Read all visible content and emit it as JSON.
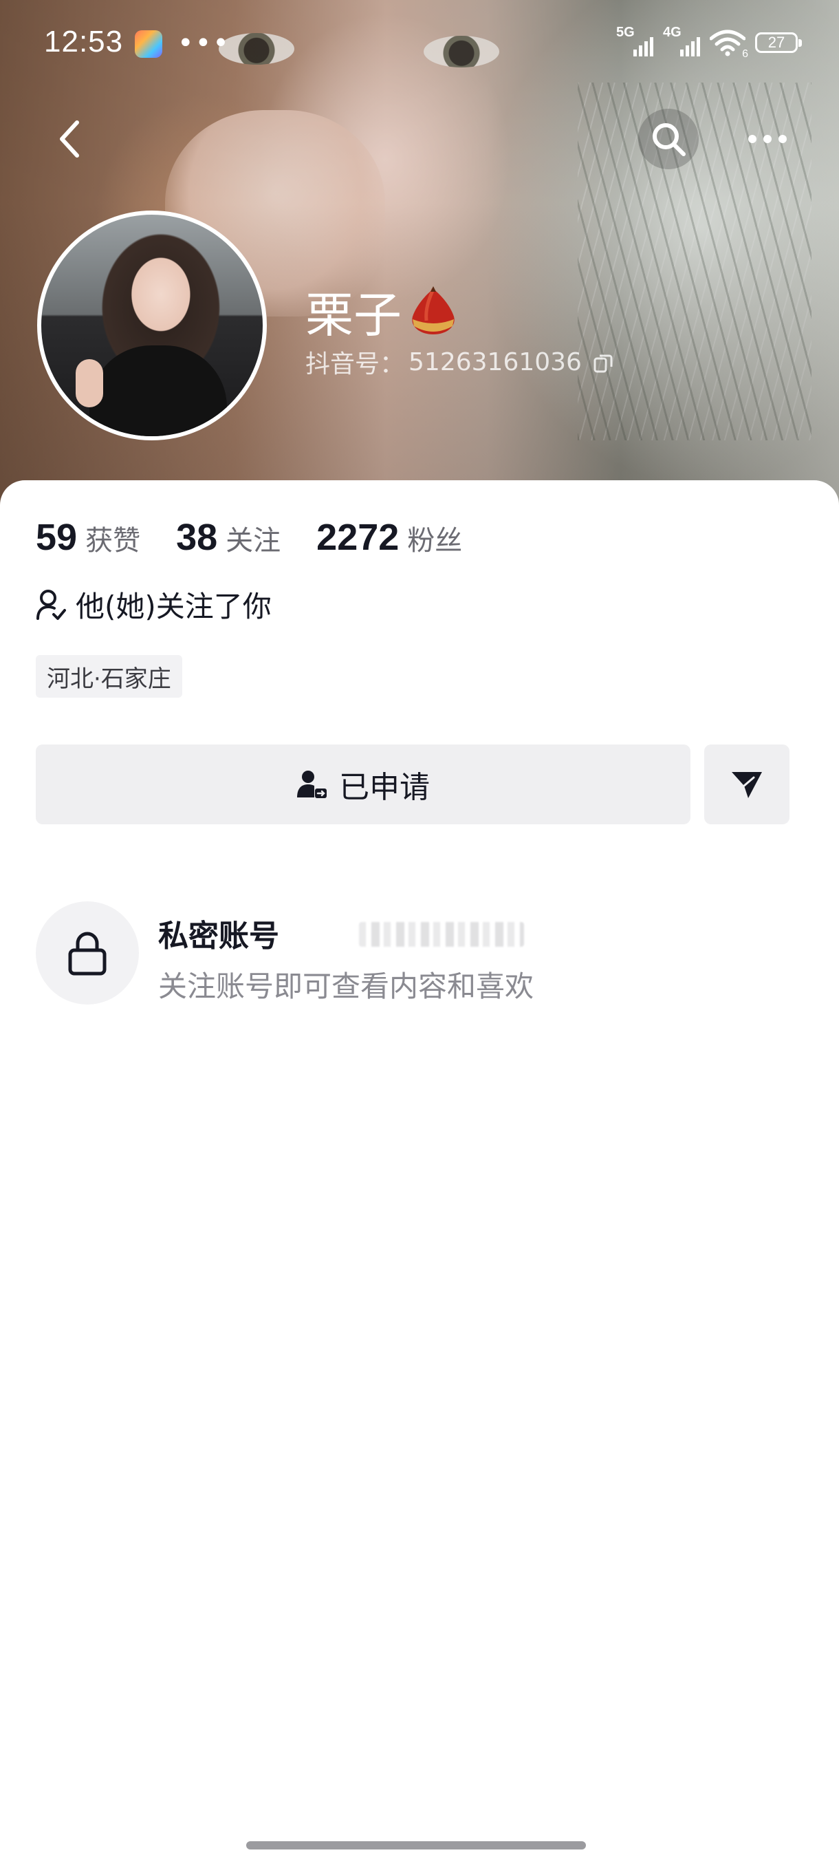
{
  "status_bar": {
    "time": "12:53",
    "dots": "•••",
    "sim1_label": "5G",
    "sim2_label": "4G",
    "wifi_sub": "6",
    "battery": "27"
  },
  "nav": {
    "back_icon": "chevron-left-icon",
    "search_icon": "search-icon",
    "more_icon": "more-horizontal-icon"
  },
  "profile": {
    "name": "栗子",
    "name_emoji": "chestnut-icon",
    "douyin_id_label": "抖音号：",
    "douyin_id": "51263161036"
  },
  "stats": [
    {
      "value": "59",
      "label": "获赞"
    },
    {
      "value": "38",
      "label": "关注"
    },
    {
      "value": "2272",
      "label": "粉丝"
    }
  ],
  "follow_note": "他(她)关注了你",
  "location": "河北·石家庄",
  "actions": {
    "applied_label": "已申请",
    "send_icon": "send-icon"
  },
  "private": {
    "title": "私密账号",
    "subtitle": "关注账号即可查看内容和喜欢"
  },
  "colors": {
    "text_primary": "#161823",
    "text_secondary": "#8a8a91",
    "button_bg": "#efeff1",
    "tag_bg": "#f2f2f4"
  }
}
